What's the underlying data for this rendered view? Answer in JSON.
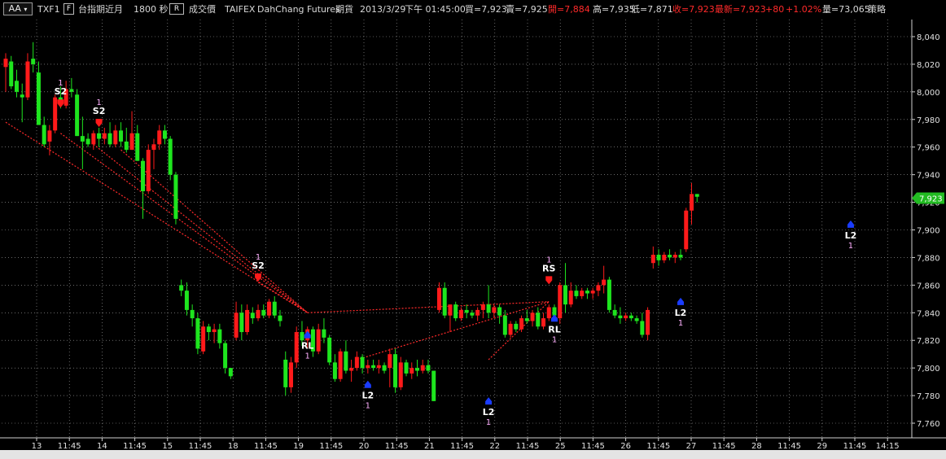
{
  "toolbar": {
    "aa_button": "AA",
    "symbol": "TXF1",
    "period_icon_glyph": "F",
    "product": "台指期近月",
    "interval": "1800 秒",
    "price_type_glyph": "R",
    "price_type": "成交價",
    "exchange": "TAIFEX",
    "broker": "DahChang Futures",
    "market": "期貨",
    "date": "2013/3/29",
    "time": "下午 01:45:00",
    "bid": "買=7,923",
    "ask": "賣=7,925",
    "open": "開=7,884",
    "high": "高=7,935",
    "low": "低=7,871",
    "close": "收=7,923",
    "last": "最新=7,923",
    "change": "+80",
    "change_pct": "+1.02%",
    "volume": "量=73,065",
    "strategy": "策略",
    "colors": {
      "up_text": "#ff2a2a",
      "normal_text": "#d8d8d8"
    }
  },
  "chart_data": {
    "type": "candlestick",
    "y_ticks": [
      "8,040",
      "8,020",
      "8,000",
      "7,980",
      "7,960",
      "7,940",
      "7,920",
      "7,900",
      "7,880",
      "7,860",
      "7,840",
      "7,820",
      "7,800",
      "7,780",
      "7,760"
    ],
    "ylim": [
      7752,
      8046
    ],
    "x_ticks": [
      "13",
      "11:45",
      "14",
      "11:45",
      "15",
      "11:45",
      "18",
      "11:45",
      "19",
      "11:45",
      "20",
      "11:45",
      "21",
      "11:45",
      "22",
      "11:45",
      "25",
      "11:45",
      "26",
      "11:45",
      "27",
      "11:45",
      "28",
      "11:45",
      "29",
      "11:45",
      "14:15"
    ],
    "last_price_label": "7,923",
    "colors": {
      "up": "#ff1a1a",
      "down": "#1ee51e",
      "grid": "#a8a8a8",
      "signal_line": "#ff2a2a",
      "label": "#ffffff",
      "count": "#ffb0ff",
      "long_marker": "#1a3cff",
      "short_marker": "#ff1a1a",
      "last_box": "#22bb22"
    },
    "candles": [
      {
        "o": 8018,
        "h": 8028,
        "l": 8000,
        "c": 8024
      },
      {
        "o": 8022,
        "h": 8026,
        "l": 8002,
        "c": 8004
      },
      {
        "o": 8008,
        "h": 8016,
        "l": 7996,
        "c": 8000
      },
      {
        "o": 7998,
        "h": 8006,
        "l": 7978,
        "c": 7996
      },
      {
        "o": 7996,
        "h": 8028,
        "l": 7994,
        "c": 8022
      },
      {
        "o": 8024,
        "h": 8036,
        "l": 8014,
        "c": 8020
      },
      {
        "o": 8014,
        "h": 8022,
        "l": 7980,
        "c": 7976
      },
      {
        "o": 7976,
        "h": 7982,
        "l": 7960,
        "c": 7962
      },
      {
        "o": 7964,
        "h": 7976,
        "l": 7954,
        "c": 7972
      },
      {
        "o": 7972,
        "h": 7998,
        "l": 7970,
        "c": 7996
      },
      {
        "o": 7996,
        "h": 8004,
        "l": 7988,
        "c": 7992
      },
      {
        "o": 7990,
        "h": 8008,
        "l": 7988,
        "c": 8002
      },
      {
        "o": 8002,
        "h": 8010,
        "l": 7996,
        "c": 8000
      },
      {
        "o": 7998,
        "h": 8002,
        "l": 7968,
        "c": 7968
      },
      {
        "o": 7968,
        "h": 7982,
        "l": 7944,
        "c": 7964
      },
      {
        "o": 7966,
        "h": 7970,
        "l": 7960,
        "c": 7962
      },
      {
        "o": 7962,
        "h": 7972,
        "l": 7958,
        "c": 7970
      },
      {
        "o": 7970,
        "h": 7974,
        "l": 7960,
        "c": 7966
      },
      {
        "o": 7966,
        "h": 7974,
        "l": 7962,
        "c": 7970
      },
      {
        "o": 7970,
        "h": 7978,
        "l": 7960,
        "c": 7962
      },
      {
        "o": 7962,
        "h": 7976,
        "l": 7960,
        "c": 7972
      },
      {
        "o": 7972,
        "h": 7978,
        "l": 7960,
        "c": 7964
      },
      {
        "o": 7964,
        "h": 7974,
        "l": 7956,
        "c": 7958
      },
      {
        "o": 7958,
        "h": 7986,
        "l": 7958,
        "c": 7970
      },
      {
        "o": 7970,
        "h": 7976,
        "l": 7950,
        "c": 7950
      },
      {
        "o": 7950,
        "h": 7952,
        "l": 7908,
        "c": 7928
      },
      {
        "o": 7928,
        "h": 7962,
        "l": 7926,
        "c": 7958
      },
      {
        "o": 7958,
        "h": 7966,
        "l": 7944,
        "c": 7962
      },
      {
        "o": 7962,
        "h": 7976,
        "l": 7958,
        "c": 7972
      },
      {
        "o": 7972,
        "h": 7976,
        "l": 7962,
        "c": 7966
      },
      {
        "o": 7966,
        "h": 7968,
        "l": 7936,
        "c": 7940
      },
      {
        "o": 7940,
        "h": 7942,
        "l": 7904,
        "c": 7908
      },
      {
        "o": 7860,
        "h": 7864,
        "l": 7852,
        "c": 7856
      },
      {
        "o": 7856,
        "h": 7862,
        "l": 7838,
        "c": 7842
      },
      {
        "o": 7842,
        "h": 7846,
        "l": 7830,
        "c": 7836
      },
      {
        "o": 7836,
        "h": 7840,
        "l": 7810,
        "c": 7814
      },
      {
        "o": 7812,
        "h": 7834,
        "l": 7810,
        "c": 7830
      },
      {
        "o": 7830,
        "h": 7832,
        "l": 7820,
        "c": 7826
      },
      {
        "o": 7826,
        "h": 7832,
        "l": 7818,
        "c": 7828
      },
      {
        "o": 7828,
        "h": 7832,
        "l": 7814,
        "c": 7818
      },
      {
        "o": 7818,
        "h": 7820,
        "l": 7796,
        "c": 7800
      },
      {
        "o": 7800,
        "h": 7800,
        "l": 7792,
        "c": 7794
      },
      {
        "o": 7822,
        "h": 7848,
        "l": 7820,
        "c": 7840
      },
      {
        "o": 7840,
        "h": 7846,
        "l": 7820,
        "c": 7826
      },
      {
        "o": 7826,
        "h": 7846,
        "l": 7824,
        "c": 7842
      },
      {
        "o": 7840,
        "h": 7844,
        "l": 7832,
        "c": 7836
      },
      {
        "o": 7836,
        "h": 7846,
        "l": 7834,
        "c": 7842
      },
      {
        "o": 7842,
        "h": 7846,
        "l": 7836,
        "c": 7838
      },
      {
        "o": 7838,
        "h": 7850,
        "l": 7836,
        "c": 7848
      },
      {
        "o": 7848,
        "h": 7852,
        "l": 7836,
        "c": 7838
      },
      {
        "o": 7838,
        "h": 7842,
        "l": 7830,
        "c": 7834
      },
      {
        "o": 7806,
        "h": 7812,
        "l": 7780,
        "c": 7786
      },
      {
        "o": 7786,
        "h": 7808,
        "l": 7782,
        "c": 7804
      },
      {
        "o": 7804,
        "h": 7830,
        "l": 7800,
        "c": 7826
      },
      {
        "o": 7826,
        "h": 7834,
        "l": 7816,
        "c": 7820
      },
      {
        "o": 7820,
        "h": 7830,
        "l": 7814,
        "c": 7828
      },
      {
        "o": 7828,
        "h": 7830,
        "l": 7808,
        "c": 7812
      },
      {
        "o": 7812,
        "h": 7832,
        "l": 7810,
        "c": 7828
      },
      {
        "o": 7828,
        "h": 7836,
        "l": 7818,
        "c": 7822
      },
      {
        "o": 7822,
        "h": 7824,
        "l": 7802,
        "c": 7804
      },
      {
        "o": 7804,
        "h": 7810,
        "l": 7790,
        "c": 7792
      },
      {
        "o": 7792,
        "h": 7814,
        "l": 7790,
        "c": 7812
      },
      {
        "o": 7812,
        "h": 7820,
        "l": 7796,
        "c": 7798
      },
      {
        "o": 7798,
        "h": 7806,
        "l": 7790,
        "c": 7800
      },
      {
        "o": 7800,
        "h": 7812,
        "l": 7798,
        "c": 7808
      },
      {
        "o": 7808,
        "h": 7810,
        "l": 7796,
        "c": 7800
      },
      {
        "o": 7800,
        "h": 7806,
        "l": 7796,
        "c": 7802
      },
      {
        "o": 7802,
        "h": 7806,
        "l": 7798,
        "c": 7800
      },
      {
        "o": 7800,
        "h": 7806,
        "l": 7796,
        "c": 7802
      },
      {
        "o": 7802,
        "h": 7804,
        "l": 7796,
        "c": 7798
      },
      {
        "o": 7800,
        "h": 7814,
        "l": 7786,
        "c": 7810
      },
      {
        "o": 7810,
        "h": 7814,
        "l": 7782,
        "c": 7786
      },
      {
        "o": 7786,
        "h": 7808,
        "l": 7784,
        "c": 7804
      },
      {
        "o": 7804,
        "h": 7806,
        "l": 7794,
        "c": 7796
      },
      {
        "o": 7796,
        "h": 7804,
        "l": 7792,
        "c": 7800
      },
      {
        "o": 7800,
        "h": 7806,
        "l": 7794,
        "c": 7798
      },
      {
        "o": 7798,
        "h": 7806,
        "l": 7796,
        "c": 7802
      },
      {
        "o": 7802,
        "h": 7806,
        "l": 7796,
        "c": 7798
      },
      {
        "o": 7798,
        "h": 7798,
        "l": 7776,
        "c": 7776
      },
      {
        "o": 7842,
        "h": 7862,
        "l": 7840,
        "c": 7858
      },
      {
        "o": 7858,
        "h": 7862,
        "l": 7836,
        "c": 7838
      },
      {
        "o": 7838,
        "h": 7844,
        "l": 7826,
        "c": 7846
      },
      {
        "o": 7846,
        "h": 7848,
        "l": 7834,
        "c": 7836
      },
      {
        "o": 7836,
        "h": 7844,
        "l": 7834,
        "c": 7842
      },
      {
        "o": 7842,
        "h": 7846,
        "l": 7836,
        "c": 7840
      },
      {
        "o": 7840,
        "h": 7842,
        "l": 7836,
        "c": 7838
      },
      {
        "o": 7838,
        "h": 7844,
        "l": 7834,
        "c": 7842
      },
      {
        "o": 7842,
        "h": 7848,
        "l": 7836,
        "c": 7846
      },
      {
        "o": 7846,
        "h": 7860,
        "l": 7836,
        "c": 7840
      },
      {
        "o": 7840,
        "h": 7846,
        "l": 7836,
        "c": 7844
      },
      {
        "o": 7844,
        "h": 7846,
        "l": 7832,
        "c": 7838
      },
      {
        "o": 7838,
        "h": 7842,
        "l": 7822,
        "c": 7824
      },
      {
        "o": 7824,
        "h": 7834,
        "l": 7822,
        "c": 7832
      },
      {
        "o": 7832,
        "h": 7834,
        "l": 7826,
        "c": 7828
      },
      {
        "o": 7828,
        "h": 7838,
        "l": 7826,
        "c": 7836
      },
      {
        "o": 7836,
        "h": 7842,
        "l": 7832,
        "c": 7834
      },
      {
        "o": 7834,
        "h": 7842,
        "l": 7830,
        "c": 7840
      },
      {
        "o": 7840,
        "h": 7844,
        "l": 7828,
        "c": 7830
      },
      {
        "o": 7830,
        "h": 7840,
        "l": 7828,
        "c": 7836
      },
      {
        "o": 7836,
        "h": 7846,
        "l": 7834,
        "c": 7844
      },
      {
        "o": 7844,
        "h": 7846,
        "l": 7834,
        "c": 7838
      },
      {
        "o": 7836,
        "h": 7862,
        "l": 7832,
        "c": 7860
      },
      {
        "o": 7860,
        "h": 7876,
        "l": 7840,
        "c": 7846
      },
      {
        "o": 7846,
        "h": 7862,
        "l": 7844,
        "c": 7856
      },
      {
        "o": 7856,
        "h": 7860,
        "l": 7850,
        "c": 7852
      },
      {
        "o": 7852,
        "h": 7858,
        "l": 7850,
        "c": 7856
      },
      {
        "o": 7856,
        "h": 7858,
        "l": 7850,
        "c": 7854
      },
      {
        "o": 7854,
        "h": 7858,
        "l": 7850,
        "c": 7856
      },
      {
        "o": 7856,
        "h": 7862,
        "l": 7852,
        "c": 7860
      },
      {
        "o": 7860,
        "h": 7874,
        "l": 7854,
        "c": 7864
      },
      {
        "o": 7864,
        "h": 7866,
        "l": 7840,
        "c": 7842
      },
      {
        "o": 7842,
        "h": 7846,
        "l": 7836,
        "c": 7838
      },
      {
        "o": 7838,
        "h": 7844,
        "l": 7832,
        "c": 7836
      },
      {
        "o": 7836,
        "h": 7840,
        "l": 7834,
        "c": 7838
      },
      {
        "o": 7838,
        "h": 7840,
        "l": 7834,
        "c": 7836
      },
      {
        "o": 7836,
        "h": 7838,
        "l": 7832,
        "c": 7834
      },
      {
        "o": 7834,
        "h": 7840,
        "l": 7822,
        "c": 7824
      },
      {
        "o": 7824,
        "h": 7844,
        "l": 7820,
        "c": 7842
      },
      {
        "o": 7876,
        "h": 7888,
        "l": 7872,
        "c": 7882
      },
      {
        "o": 7882,
        "h": 7886,
        "l": 7874,
        "c": 7878
      },
      {
        "o": 7878,
        "h": 7884,
        "l": 7876,
        "c": 7882
      },
      {
        "o": 7882,
        "h": 7886,
        "l": 7878,
        "c": 7880
      },
      {
        "o": 7880,
        "h": 7884,
        "l": 7876,
        "c": 7882
      },
      {
        "o": 7882,
        "h": 7886,
        "l": 7878,
        "c": 7880
      },
      {
        "o": 7886,
        "h": 7916,
        "l": 7884,
        "c": 7914
      },
      {
        "o": 7914,
        "h": 7934,
        "l": 7904,
        "c": 7926
      },
      {
        "o": 7926,
        "h": 7926,
        "l": 7920,
        "c": 7924
      }
    ],
    "signals": [
      {
        "label": "S2",
        "count": "1",
        "type": "short",
        "bar": 10,
        "price": 7988
      },
      {
        "label": "S2",
        "count": "1",
        "type": "short",
        "bar": 17,
        "price": 7974
      },
      {
        "label": "S2",
        "count": "1",
        "type": "short",
        "bar": 46,
        "price": 7862
      },
      {
        "label": "RL",
        "count": "1",
        "type": "long",
        "bar": 55,
        "price": 7828
      },
      {
        "label": "L2",
        "count": "1",
        "type": "long",
        "bar": 66,
        "price": 7792
      },
      {
        "label": "L2",
        "count": "1",
        "type": "long",
        "bar": 88,
        "price": 7780
      },
      {
        "label": "RS",
        "count": "1",
        "type": "short",
        "bar": 99,
        "price": 7860
      },
      {
        "label": "RL",
        "count": "1",
        "type": "long",
        "bar": 100,
        "price": 7840
      },
      {
        "label": "L2",
        "count": "1",
        "type": "long",
        "bar": 123,
        "price": 7852
      },
      {
        "label": "L2",
        "count": "1",
        "type": "long",
        "bar": 154,
        "price": 7908
      }
    ],
    "trade_lines": [
      {
        "from": [
          0,
          7978
        ],
        "to": [
          55,
          7840
        ]
      },
      {
        "from": [
          10,
          7970
        ],
        "to": [
          55,
          7840
        ]
      },
      {
        "from": [
          16,
          7962
        ],
        "to": [
          55,
          7840
        ]
      },
      {
        "from": [
          21,
          7958
        ],
        "to": [
          55,
          7840
        ]
      },
      {
        "from": [
          46,
          7862
        ],
        "to": [
          55,
          7840
        ]
      },
      {
        "from": [
          55,
          7840
        ],
        "to": [
          99,
          7848
        ]
      },
      {
        "from": [
          64,
          7806
        ],
        "to": [
          99,
          7848
        ]
      },
      {
        "from": [
          88,
          7806
        ],
        "to": [
          99,
          7848
        ]
      }
    ]
  }
}
